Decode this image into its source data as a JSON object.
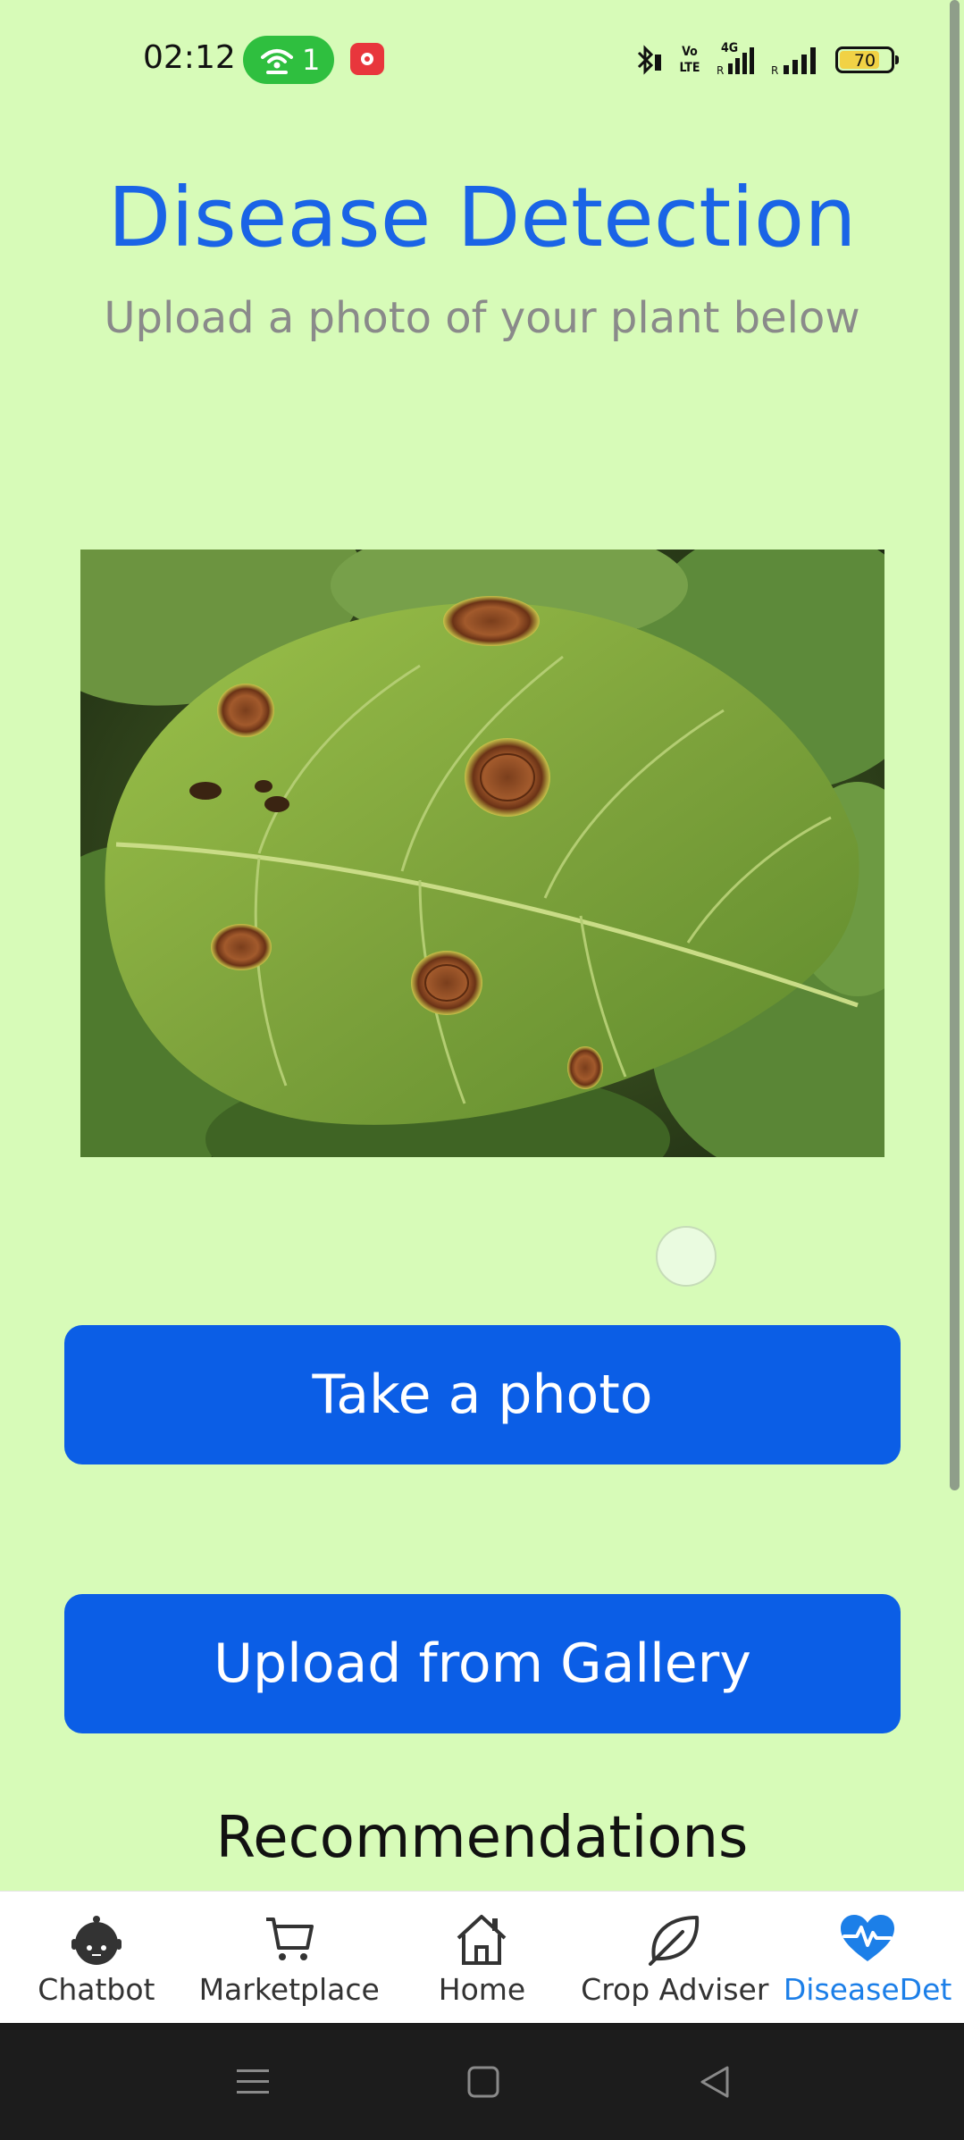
{
  "status_bar": {
    "time": "02:12",
    "hotspot_count": "1",
    "volte_label": "Vo LTE",
    "network_label": "4G",
    "battery_level": "70"
  },
  "header": {
    "title": "Disease Detection",
    "subtitle": "Upload a photo of your plant below"
  },
  "buttons": {
    "take_photo": "Take a photo",
    "upload_gallery": "Upload from Gallery"
  },
  "recommendations": {
    "heading": "Recommendations"
  },
  "bottom_nav": {
    "items": [
      {
        "label": "Chatbot",
        "icon": "robot-icon"
      },
      {
        "label": "Marketplace",
        "icon": "cart-icon"
      },
      {
        "label": "Home",
        "icon": "home-icon"
      },
      {
        "label": "Crop Adviser",
        "icon": "leaf-icon"
      },
      {
        "label": "DiseaseDet",
        "icon": "heart-pulse-icon",
        "active": true
      }
    ]
  },
  "colors": {
    "background": "#d7fbb8",
    "title": "#1a64e6",
    "button": "#0b5ee6",
    "active_nav": "#1c7fe8"
  }
}
